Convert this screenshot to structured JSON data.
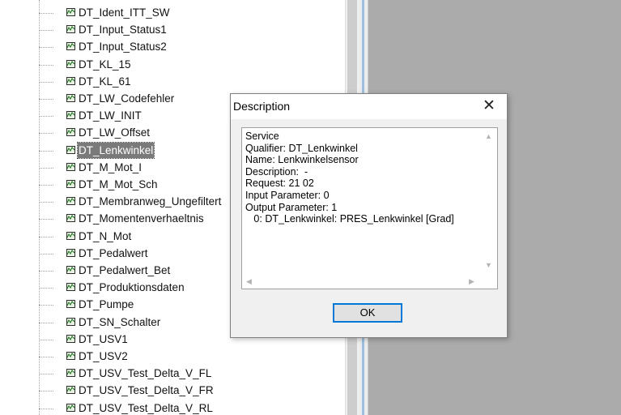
{
  "tree": {
    "items": [
      {
        "label": "DT_Ident_ITT_SW",
        "selected": false
      },
      {
        "label": "DT_Input_Status1",
        "selected": false
      },
      {
        "label": "DT_Input_Status2",
        "selected": false
      },
      {
        "label": "DT_KL_15",
        "selected": false
      },
      {
        "label": "DT_KL_61",
        "selected": false
      },
      {
        "label": "DT_LW_Codefehler",
        "selected": false
      },
      {
        "label": "DT_LW_INIT",
        "selected": false
      },
      {
        "label": "DT_LW_Offset",
        "selected": false
      },
      {
        "label": "DT_Lenkwinkel",
        "selected": true
      },
      {
        "label": "DT_M_Mot_I",
        "selected": false
      },
      {
        "label": "DT_M_Mot_Sch",
        "selected": false
      },
      {
        "label": "DT_Membranweg_Ungefiltert",
        "selected": false
      },
      {
        "label": "DT_Momentenverhaeltnis",
        "selected": false
      },
      {
        "label": "DT_N_Mot",
        "selected": false
      },
      {
        "label": "DT_Pedalwert",
        "selected": false
      },
      {
        "label": "DT_Pedalwert_Bet",
        "selected": false
      },
      {
        "label": "DT_Produktionsdaten",
        "selected": false
      },
      {
        "label": "DT_Pumpe",
        "selected": false
      },
      {
        "label": "DT_SN_Schalter",
        "selected": false
      },
      {
        "label": "DT_USV1",
        "selected": false
      },
      {
        "label": "DT_USV2",
        "selected": false
      },
      {
        "label": "DT_USV_Test_Delta_V_FL",
        "selected": false
      },
      {
        "label": "DT_USV_Test_Delta_V_FR",
        "selected": false
      },
      {
        "label": "DT_USV_Test_Delta_V_RL",
        "selected": false
      }
    ],
    "item_icon": "service-tree-icon"
  },
  "dialog": {
    "title": "Description",
    "close_symbol": "✕",
    "text_lines": [
      "Service",
      "Qualifier: DT_Lenkwinkel",
      "Name: Lenkwinkelsensor",
      "Description:  -",
      "Request: 21 02",
      "Input Parameter: 0",
      "Output Parameter: 1",
      "   0: DT_Lenkwinkel: PRES_Lenkwinkel [Grad]"
    ],
    "ok_label": "OK"
  },
  "colors": {
    "selection": "#7a7a7a",
    "right_pane": "#ababab",
    "ok_border": "#0078d7"
  }
}
